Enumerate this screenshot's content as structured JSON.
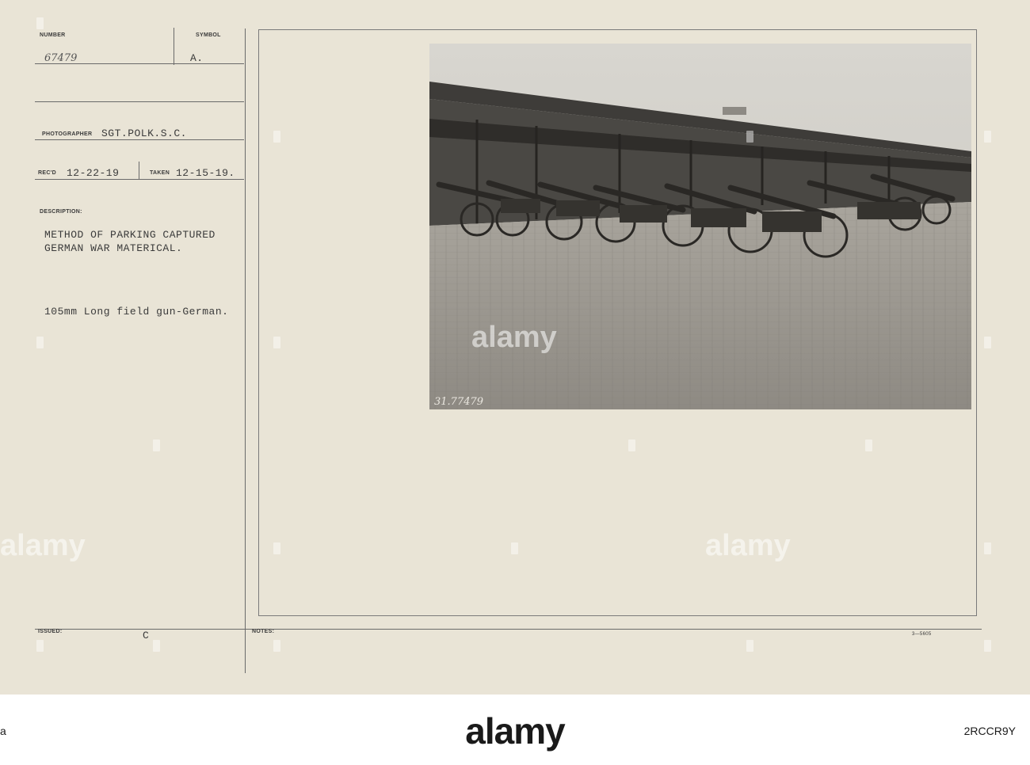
{
  "card": {
    "number_label": "NUMBER",
    "number_value": "67479",
    "symbol_label": "SYMBOL",
    "symbol_value": "A.",
    "photographer_label": "PHOTOGRAPHER",
    "photographer_value": "SGT.POLK.S.C.",
    "recd_label": "REC'D",
    "recd_value": "12-22-19",
    "taken_label": "TAKEN",
    "taken_value": "12-15-19.",
    "description_label": "DESCRIPTION:",
    "description_line1": "METHOD OF PARKING CAPTURED",
    "description_line2": "GERMAN WAR MATERICAL.",
    "caption": "105mm Long field gun-German.",
    "issued_label": "ISSUED:",
    "issued_value": "C",
    "notes_label": "NOTES:",
    "form_number": "3—5605"
  },
  "photo": {
    "negative_number": "31.77479",
    "subject": "rows of parked field guns in front of a long shed"
  },
  "watermark": {
    "text": "alamy"
  },
  "footer": {
    "logo": "alamy",
    "image_id": "2RCCR9Y",
    "left_text": "a"
  },
  "colors": {
    "card_background": "#e9e4d6",
    "footer_background": "#ffffff",
    "ink": "#3b3b3b"
  }
}
